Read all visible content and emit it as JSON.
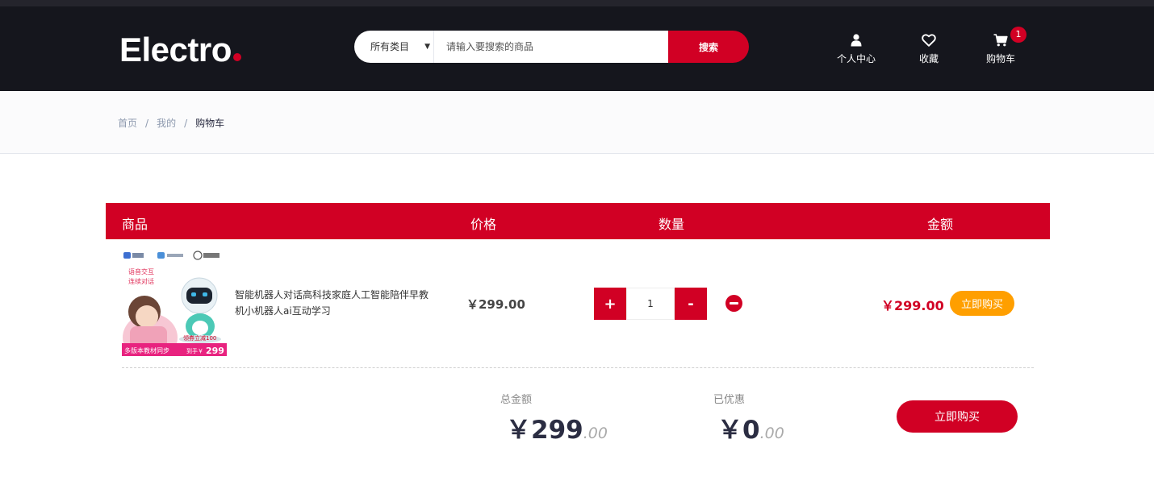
{
  "header": {
    "logo": "Electro",
    "search": {
      "category": "所有类目",
      "placeholder": "请输入要搜索的商品",
      "button": "搜索"
    },
    "user_label": "个人中心",
    "fav_label": "收藏",
    "cart_label": "购物车",
    "cart_count": "1"
  },
  "breadcrumb": {
    "home": "首页",
    "mine": "我的",
    "current": "购物车",
    "sep": "/"
  },
  "table": {
    "headers": {
      "goods": "商品",
      "price": "价格",
      "qty": "数量",
      "amount": "金额"
    },
    "items": [
      {
        "name": "智能机器人对话高科技家庭人工智能陪伴早教机小机器人ai互动学习",
        "price": "￥299.00",
        "qty": "1",
        "plus": "+",
        "minus": "-",
        "amount": "￥299.00",
        "buy": "立即购买",
        "thumb": {
          "tag1": "语音交互",
          "tag2": "连续对话",
          "banner": "多版本教材同步",
          "coupon": "领券立减100",
          "price_tag": "到手￥",
          "price_num": "299"
        }
      }
    ]
  },
  "totals": {
    "total_label": "总金额",
    "total_int": "￥299",
    "total_cents": ".00",
    "discount_label": "已优惠",
    "discount_int": "￥0",
    "discount_cents": ".00",
    "buy": "立即购买"
  },
  "colors": {
    "accent": "#d10024",
    "header_bg": "#15161d",
    "orange": "#ff9f00"
  }
}
